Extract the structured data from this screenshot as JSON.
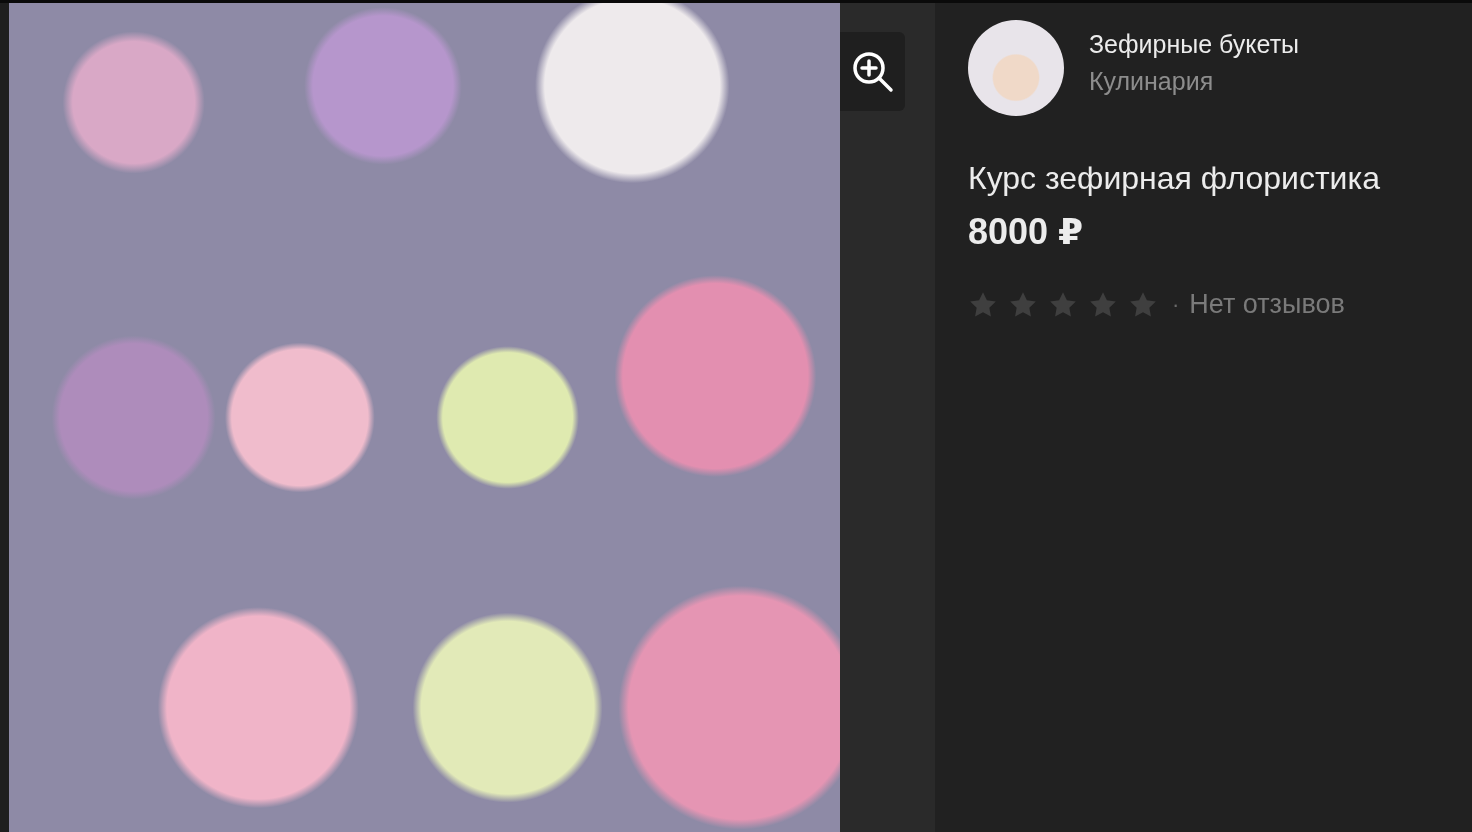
{
  "seller": {
    "name": "Зефирные букеты",
    "category": "Кулинария"
  },
  "product": {
    "title": "Курс зефирная флористика",
    "price": "8000 ₽"
  },
  "rating": {
    "stars": 0,
    "separator": "·",
    "reviews": "Нет отзывов"
  }
}
